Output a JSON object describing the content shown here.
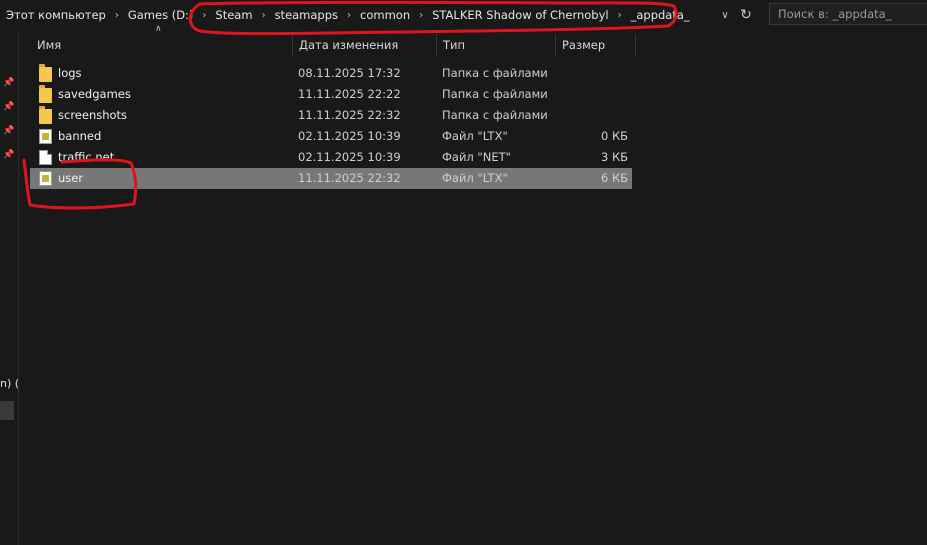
{
  "breadcrumb": [
    "Этот компьютер",
    "Games (D:)",
    "Steam",
    "steamapps",
    "common",
    "STALKER Shadow of Chernobyl",
    "_appdata_"
  ],
  "search": {
    "placeholder": "Поиск в: _appdata_"
  },
  "columns": {
    "name": "Имя",
    "date": "Дата изменения",
    "type": "Тип",
    "size": "Размер"
  },
  "files": [
    {
      "name": "logs",
      "date": "08.11.2025 17:32",
      "type": "Папка с файлами",
      "size": "",
      "icon": "folder-icon"
    },
    {
      "name": "savedgames",
      "date": "11.11.2025 22:22",
      "type": "Папка с файлами",
      "size": "",
      "icon": "folder-icon"
    },
    {
      "name": "screenshots",
      "date": "11.11.2025 22:32",
      "type": "Папка с файлами",
      "size": "",
      "icon": "folder-icon"
    },
    {
      "name": "banned",
      "date": "02.11.2025 10:39",
      "type": "Файл \"LTX\"",
      "size": "0 КБ",
      "icon": "ltx-file-icon"
    },
    {
      "name": "traffic.net",
      "date": "02.11.2025 10:39",
      "type": "Файл \"NET\"",
      "size": "3 КБ",
      "icon": "file-icon"
    },
    {
      "name": "user",
      "date": "11.11.2025 22:32",
      "type": "Файл \"LTX\"",
      "size": "6 КБ",
      "icon": "ltx-file-icon",
      "selected": true
    }
  ],
  "navpane": {
    "partial_text": "n) ("
  },
  "colors": {
    "background": "#191919",
    "selection": "#777777",
    "annotation": "#e0141e"
  }
}
